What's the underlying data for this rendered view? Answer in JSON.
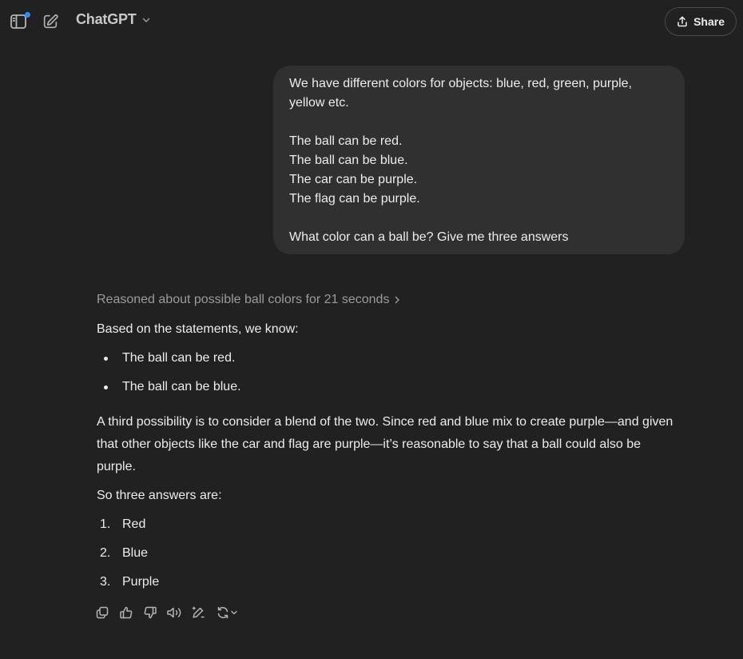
{
  "header": {
    "model_name": "ChatGPT",
    "share_label": "Share",
    "icons": [
      "sidebar-toggle-icon",
      "new-chat-icon",
      "chevron-down-icon",
      "share-icon"
    ]
  },
  "user_message": {
    "lines": [
      "We have different colors for objects: blue, red, green, purple,",
      "yellow etc.",
      "",
      "The ball can be red.",
      "The ball can be blue.",
      "The car can be purple.",
      "The flag can be purple.",
      "",
      "What color can a ball be? Give me three answers"
    ]
  },
  "assistant": {
    "reasoning_label": "Reasoned about possible ball colors for 21 seconds",
    "intro": "Based on the statements, we know:",
    "bullets": [
      "The ball can be red.",
      "The ball can be blue."
    ],
    "paragraph": "A third possibility is to consider a blend of the two. Since red and blue mix to create purple—and given that other objects like the car and flag are purple—it’s reasonable to say that a ball could also be purple.",
    "subheading": "So three answers are:",
    "numbered": [
      {
        "num": "1.",
        "text": "Red"
      },
      {
        "num": "2.",
        "text": "Blue"
      },
      {
        "num": "3.",
        "text": "Purple"
      }
    ]
  },
  "actions": [
    "copy-icon",
    "thumbs-up-icon",
    "thumbs-down-icon",
    "read-aloud-icon",
    "edit-canvas-icon",
    "regenerate-icon"
  ],
  "colors": {
    "background": "#212121",
    "bubble": "#303030",
    "text": "#ececec",
    "muted": "#9b9b9b",
    "notification": "#2f8cff"
  }
}
